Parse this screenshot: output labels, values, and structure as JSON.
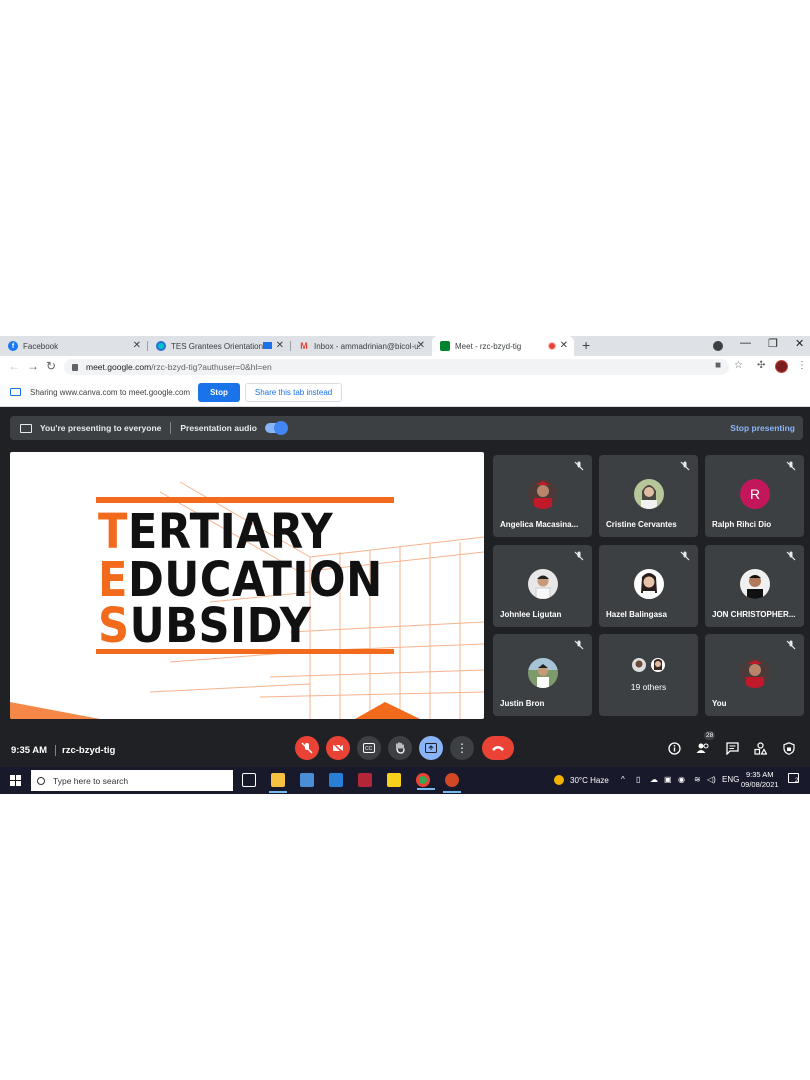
{
  "browser": {
    "tabs": [
      {
        "title": "Facebook",
        "icon": "facebook-icon"
      },
      {
        "title": "TES Grantees Orientation - F",
        "icon": "canva-icon"
      },
      {
        "title": "Inbox - ammadrinian@bicol-u.ed",
        "icon": "gmail-icon"
      },
      {
        "title": "Meet - rzc-bzyd-tig",
        "icon": "meet-icon"
      }
    ],
    "new_tab_label": "+",
    "url_host": "meet.google.com",
    "url_path": "/rzc-bzyd-tig?authuser=0&hl=en"
  },
  "sharing_bar": {
    "message": "Sharing www.canva.com to meet.google.com",
    "stop_label": "Stop",
    "share_tab_label": "Share this tab instead"
  },
  "present_bar": {
    "presenting_text": "You're presenting to everyone",
    "audio_label": "Presentation audio",
    "stop_label": "Stop presenting"
  },
  "slide": {
    "line1_initial": "T",
    "line1_rest": "ERTIARY",
    "line2_initial": "E",
    "line2_rest": "DUCATION",
    "line3_initial": "S",
    "line3_rest": "UBSIDY",
    "accent": "#f26a1b"
  },
  "participants": [
    {
      "name": "Angelica Macasina...",
      "avatar": "photo"
    },
    {
      "name": "Cristine Cervantes",
      "avatar": "photo"
    },
    {
      "name": "Ralph Rihci Dio",
      "avatar": "R"
    },
    {
      "name": "Johnlee Ligutan",
      "avatar": "photo"
    },
    {
      "name": "Hazel Balingasa",
      "avatar": "photo"
    },
    {
      "name": "JON CHRISTOPHER...",
      "avatar": "photo"
    },
    {
      "name": "Justin Bron",
      "avatar": "photo"
    },
    {
      "name": "",
      "avatar": "group",
      "others": "19 others"
    },
    {
      "name": "You",
      "avatar": "photo"
    }
  ],
  "meeting": {
    "time": "9:35 AM",
    "code": "rzc-bzyd-tig",
    "participant_count": "28"
  },
  "taskbar": {
    "search_placeholder": "Type here to search",
    "weather": "30°C  Haze",
    "language": "ENG",
    "time": "9:35 AM",
    "date": "09/08/2021",
    "notification_count": "2"
  },
  "colors": {
    "meet_bg": "#202124",
    "tile_bg": "#3c4043",
    "end_call": "#ea4335",
    "accent_blue": "#8ab4f8",
    "ralph_avatar": "#c2185b"
  }
}
